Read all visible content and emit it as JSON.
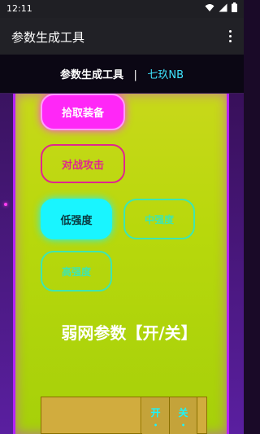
{
  "status_bar": {
    "time": "12:11"
  },
  "app_bar": {
    "title": "参数生成工具"
  },
  "header": {
    "title": "参数生成工具",
    "separator": "|",
    "author": "七玖NB"
  },
  "buttons": {
    "pick": "拾取装备",
    "battle": "对战攻击",
    "low": "低强度",
    "mid": "中强度",
    "high": "高强度"
  },
  "weak_network": {
    "title": "弱网参数【开/关】",
    "open": "开",
    "close": "关"
  },
  "colors": {
    "pink": "#ff27f7",
    "cyan": "#19f5ff",
    "lime": "#c8d81a",
    "purple": "#b522ff"
  }
}
